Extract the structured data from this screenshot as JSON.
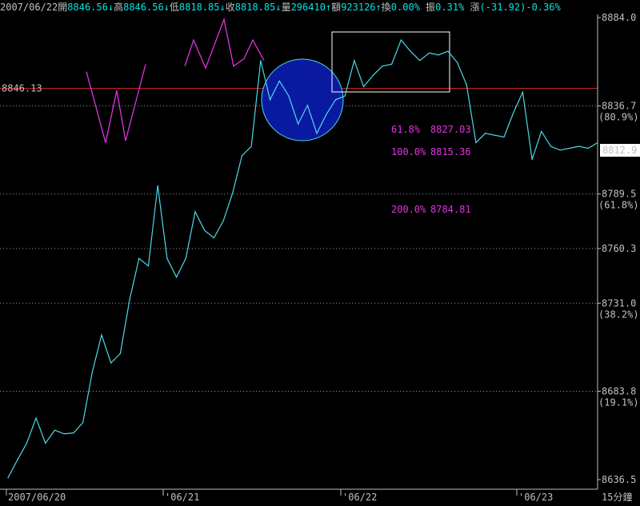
{
  "header": {
    "date": "2007/06/22",
    "open_label": "開",
    "open_value": "8846.56",
    "open_arrow": "↓",
    "high_label": "高",
    "high_value": "8846.56",
    "high_arrow": "↓",
    "low_label": "低",
    "low_value": "8818.85",
    "low_arrow": "↓",
    "close_label": "收",
    "close_value": "8818.85",
    "close_arrow": "↓",
    "volume_label": "量",
    "volume_value": "296410",
    "volume_arrow": "↑",
    "amount_label": "額",
    "amount_value": "923126",
    "amount_arrow": "↑",
    "turnover_label": "換",
    "turnover_value": "0.00%",
    "amplitude_label": "振",
    "amplitude_value": "0.31%",
    "change_label": "漲",
    "change_value": "(-31.92)-0.36%"
  },
  "colors": {
    "price_line": "#4dd9e6",
    "pattern_line": "#e033e0",
    "ref_line": "#cc2222",
    "ref_label": "#ff3333",
    "circle_fill": "#0a1aa0",
    "circle_stroke": "#4dd9e6",
    "box": "#ffffff",
    "axis": "#c0c0c0",
    "grid": "#9a9a9a"
  },
  "chart_data": {
    "type": "line",
    "y_axis": {
      "ticks": [
        {
          "value": 8884.0,
          "label": "8884.0",
          "sub": ""
        },
        {
          "value": 8836.7,
          "label": "8836.7",
          "sub": "(80.9%)"
        },
        {
          "value": 8789.5,
          "label": "8789.5",
          "sub": "(61.8%)"
        },
        {
          "value": 8760.3,
          "label": "8760.3",
          "sub": ""
        },
        {
          "value": 8731.0,
          "label": "8731.0",
          "sub": "(38.2%)"
        },
        {
          "value": 8683.8,
          "label": "8683.8",
          "sub": "(19.1%)"
        },
        {
          "value": 8636.5,
          "label": "8636.5",
          "sub": ""
        }
      ],
      "ylim": [
        8636.5,
        8884.0
      ]
    },
    "x_axis": {
      "labels": [
        {
          "index": 0,
          "label": "2007/06/20"
        },
        {
          "index": 18,
          "label": "'06/21"
        },
        {
          "index": 37,
          "label": "'06/22"
        },
        {
          "index": 56,
          "label": "'06/23"
        }
      ],
      "interval_label": "15分鐘"
    },
    "series": [
      {
        "values": [
          8637.5,
          8647.0,
          8656.0,
          8669.5,
          8656.0,
          8663.0,
          8661.0,
          8661.5,
          8667.0,
          8694.0,
          8714.0,
          8699.0,
          8704.0,
          8733.0,
          8755.0,
          8751.0,
          8794.0,
          8755.0,
          8745.0,
          8755.0,
          8780.0,
          8770.0,
          8766.0,
          8775.0,
          8790.0,
          8810.0,
          8815.0,
          8861.0,
          8840.0,
          8850.0,
          8842.0,
          8827.0,
          8837.0,
          8822.0,
          8832.0,
          8840.0,
          8842.0,
          8861.0,
          8847.0,
          8853.0,
          8858.0,
          8859.0,
          8872.0,
          8866.0,
          8861.0,
          8865.0,
          8864.0,
          8866.0,
          8860.0,
          8848.0,
          8817.0,
          8822.0,
          8821.0,
          8820.0,
          8833.0,
          8844.0,
          8808.0,
          8823.0,
          8815.0,
          8813.0,
          8814.0,
          8815.0,
          8814.0,
          8817.0
        ]
      }
    ],
    "reference_line": {
      "value": 8846.13,
      "label": "8846.13"
    },
    "last_price_label": "8812.9",
    "fib_levels": [
      {
        "pct": "61.8%",
        "value": "8827.03"
      },
      {
        "pct": "100.0%",
        "value": "8815.36"
      },
      {
        "pct": "200.0%",
        "value": "8784.81"
      }
    ],
    "pattern_w_values": [
      8855.0,
      8817.0,
      8845.0,
      8818.0,
      8859.0
    ],
    "pattern_m_values": [
      8858.0,
      8872.0,
      8857.0,
      8883.0,
      8858.0,
      8862.0,
      8872.0,
      8861.0
    ]
  }
}
